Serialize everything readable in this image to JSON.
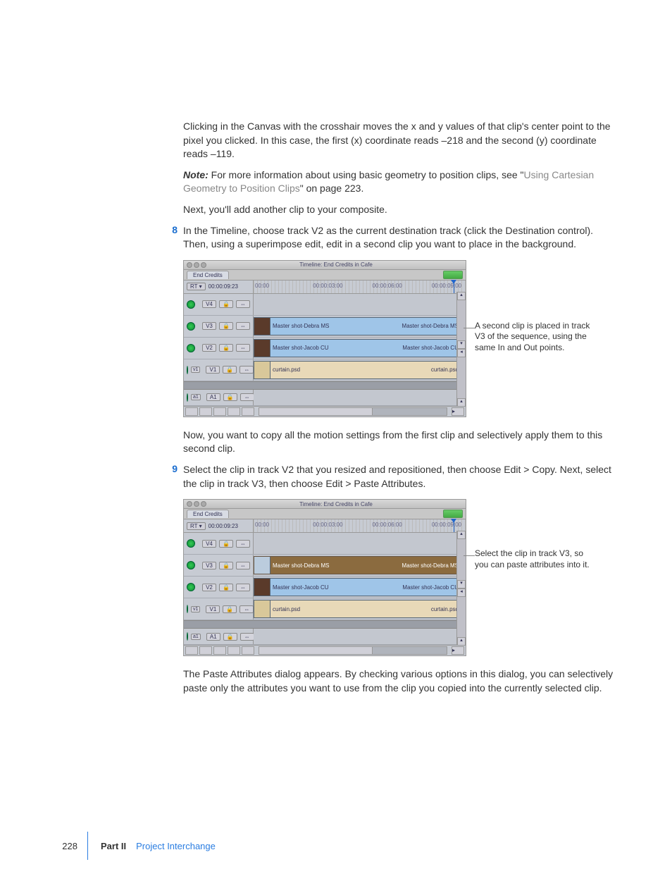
{
  "para1": "Clicking in the Canvas with the crosshair moves the x and y values of that clip's center point to the pixel you clicked. In this case, the first (x) coordinate reads –218 and the second (y) coordinate reads –119.",
  "note_label": "Note:",
  "note_text_1": "  For more information about using basic geometry to position clips, see \"",
  "note_link": "Using Cartesian Geometry to Position Clips",
  "note_text_2": "\" on page 223.",
  "para2": "Next, you'll add another clip to your composite.",
  "step8_num": "8",
  "step8": "In the Timeline, choose track V2 as the current destination track (click the Destination control). Then, using a superimpose edit, edit in a second clip you want to place in the background.",
  "callout1": "A second clip is placed in track V3 of the sequence, using the same In and Out points.",
  "para3": "Now, you want to copy all the motion settings from the first clip and selectively apply them to this second clip.",
  "step9_num": "9",
  "step9": "Select the clip in track V2 that you resized and repositioned, then choose Edit > Copy. Next, select the clip in track V3, then choose Edit > Paste Attributes.",
  "callout2": "Select the clip in track V3, so you can paste attributes into it.",
  "para4": "The Paste Attributes dialog appears. By checking various options in this dialog, you can selectively paste only the attributes you want to use from the clip you copied into the currently selected clip.",
  "page_num": "228",
  "part": "Part II",
  "section": "Project Interchange",
  "tl": {
    "title": "Timeline: End Credits in Cafe",
    "tab": "End Credits",
    "rt": "RT ▾",
    "timecode": "00:00:09:23",
    "ticks": [
      "00:00",
      "00:00:03:00",
      "00:00:06:00",
      "00:00:09:00"
    ],
    "tracks": {
      "v4": "V4",
      "v3": "V3",
      "v2": "V2",
      "v1": "V1",
      "a1": "A1",
      "src_v1": "v1",
      "src_a1": "a1"
    },
    "lock": "🔒",
    "mute": "⇔",
    "clips": {
      "v3_name": "Master shot-Debra MS",
      "v3_end": "Master shot-Debra MS",
      "v2_name": "Master shot-Jacob CU",
      "v2_end": "Master shot-Jacob CU",
      "v1_name": "curtain.psd",
      "v1_end": "curtain.psd"
    }
  }
}
